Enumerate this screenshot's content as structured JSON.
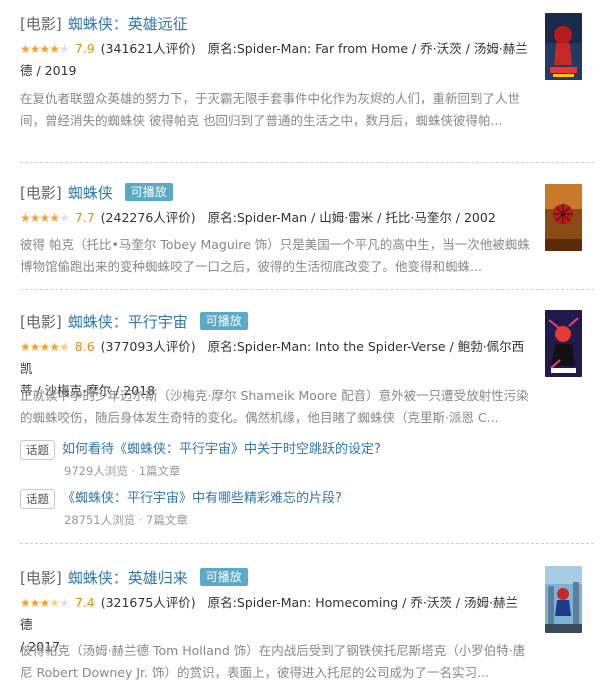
{
  "results": [
    {
      "category": "[电影]",
      "title": "蜘蛛侠：英雄远征",
      "badge": "",
      "stars": 4,
      "rating": "7.9",
      "votes": "(341621人评价)",
      "meta_line1": "原名:Spider-Man: Far from Home / 乔·沃茨 / 汤姆·赫兰",
      "meta_line2": "德 / 2019",
      "desc": "在复仇者联盟众英雄的努力下，于灭霸无限手套事件中化作为灰烬的人们，重新回到了人世间，曾经消失的蜘蛛侠 彼得帕克 也回归到了普通的生活之中，数月后，蜘蛛侠彼得帕..."
    },
    {
      "category": "[电影]",
      "title": "蜘蛛侠",
      "badge": "可播放",
      "stars": 4,
      "rating": "7.7",
      "votes": "(242276人评价)",
      "meta_line1": "原名:Spider-Man / 山姆·雷米 / 托比·马奎尔 / 2002",
      "meta_line2": "",
      "desc": "彼得 帕克（托比•马奎尔 Tobey Maguire 饰）只是美国一个平凡的高中生，当一次他被蜘蛛博物馆偷跑出来的变种蜘蛛咬了一口之后，彼得的生活彻底改变了。他变得和蜘蛛..."
    },
    {
      "category": "[电影]",
      "title": "蜘蛛侠：平行宇宙",
      "badge": "可播放",
      "stars": 4.5,
      "rating": "8.6",
      "votes": "(377093人评价)",
      "meta_line1": "原名:Spider-Man: Into the Spider-Verse / 鲍勃·佩尔西凯",
      "meta_line2": "蒂 / 沙梅克·摩尔 / 2018",
      "desc": "正就读中学的少年迈尔斯（沙梅克·摩尔 Shameik Moore 配音）意外被一只遭受放射性污染的蜘蛛咬伤，随后身体发生奇特的变化。偶然机缘，他目睹了蜘蛛侠（克里斯·派恩 C..."
    },
    {
      "category": "[电影]",
      "title": "蜘蛛侠：英雄归来",
      "badge": "可播放",
      "stars": 3.5,
      "rating": "7.4",
      "votes": "(321675人评价)",
      "meta_line1": "原名:Spider-Man: Homecoming / 乔·沃茨 / 汤姆·赫兰德",
      "meta_line2": "/ 2017",
      "desc": "彼得帕克（汤姆·赫兰德 Tom Holland 饰）在内战后受到了钢铁侠托尼斯塔克（小罗伯特·唐尼 Robert Downey Jr. 饰）的赏识，表面上，彼得进入托尼的公司成为了一名实习..."
    }
  ],
  "topics": [
    {
      "tag": "话题",
      "title": "如何看待《蜘蛛侠：平行宇宙》中关于时空跳跃的设定?",
      "stats": "9729人浏览 · 1篇文章"
    },
    {
      "tag": "话题",
      "title": "《蜘蛛侠：平行宇宙》中有哪些精彩难忘的片段?",
      "stats": "28751人浏览 · 7篇文章"
    }
  ]
}
